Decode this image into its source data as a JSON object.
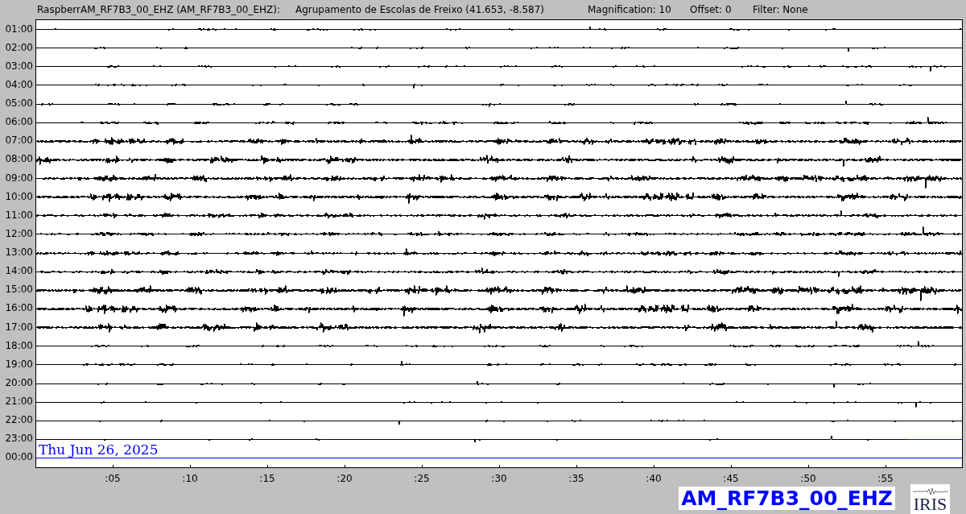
{
  "header": {
    "station": "RaspberrAM_RF7B3_00_EHZ (AM_RF7B3_00_EHZ):",
    "location": "Agrupamento de Escolas de Freixo (41.653, -8.587)",
    "magnification": "Magnification: 10",
    "offset": "Offset: 0",
    "filter": "Filter: None"
  },
  "helicorder": {
    "rows": [
      {
        "time": "01:00",
        "color": "#000000"
      },
      {
        "time": "02:00",
        "color": "#000000"
      },
      {
        "time": "03:00",
        "color": "#000000"
      },
      {
        "time": "04:00",
        "color": "#000000"
      },
      {
        "time": "05:00",
        "color": "#000000"
      },
      {
        "time": "06:00",
        "color": "#000000"
      },
      {
        "time": "07:00",
        "color": "#000000"
      },
      {
        "time": "08:00",
        "color": "#000000"
      },
      {
        "time": "09:00",
        "color": "#000000"
      },
      {
        "time": "10:00",
        "color": "#000000"
      },
      {
        "time": "11:00",
        "color": "#000000"
      },
      {
        "time": "12:00",
        "color": "#000000"
      },
      {
        "time": "13:00",
        "color": "#000000"
      },
      {
        "time": "14:00",
        "color": "#000000"
      },
      {
        "time": "15:00",
        "color": "#000000"
      },
      {
        "time": "16:00",
        "color": "#000000"
      },
      {
        "time": "17:00",
        "color": "#000000"
      },
      {
        "time": "18:00",
        "color": "#000000"
      },
      {
        "time": "19:00",
        "color": "#000000"
      },
      {
        "time": "20:00",
        "color": "#000000"
      },
      {
        "time": "21:00",
        "color": "#000000"
      },
      {
        "time": "22:00",
        "color": "#000000"
      },
      {
        "time": "23:00",
        "color": "#000000"
      },
      {
        "time": "00:00",
        "color": "#0000ff"
      }
    ],
    "date_label": "Thu Jun 26, 2025",
    "x_ticks": [
      ":05",
      ":10",
      ":15",
      ":20",
      ":25",
      ":30",
      ":35",
      ":40",
      ":45",
      ":50",
      ":55"
    ]
  },
  "channel_label": "AM_RF7B3_00_EHZ",
  "logo": "IRIS"
}
